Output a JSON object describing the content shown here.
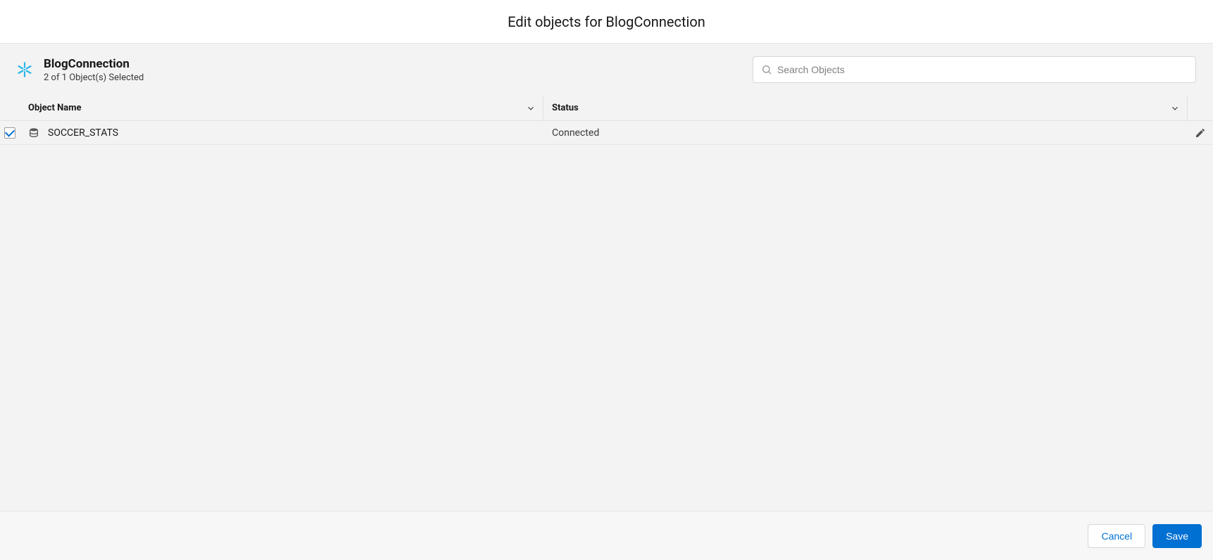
{
  "header": {
    "page_title": "Edit objects for BlogConnection"
  },
  "connection": {
    "name": "BlogConnection",
    "subtext": "2 of 1 Object(s) Selected",
    "icon": "snowflake-icon"
  },
  "search": {
    "placeholder": "Search Objects",
    "value": ""
  },
  "columns": {
    "name_header": "Object Name",
    "status_header": "Status"
  },
  "rows": [
    {
      "checked": true,
      "icon": "database-icon",
      "name": "SOCCER_STATS",
      "status": "Connected"
    }
  ],
  "footer": {
    "cancel_label": "Cancel",
    "save_label": "Save"
  }
}
